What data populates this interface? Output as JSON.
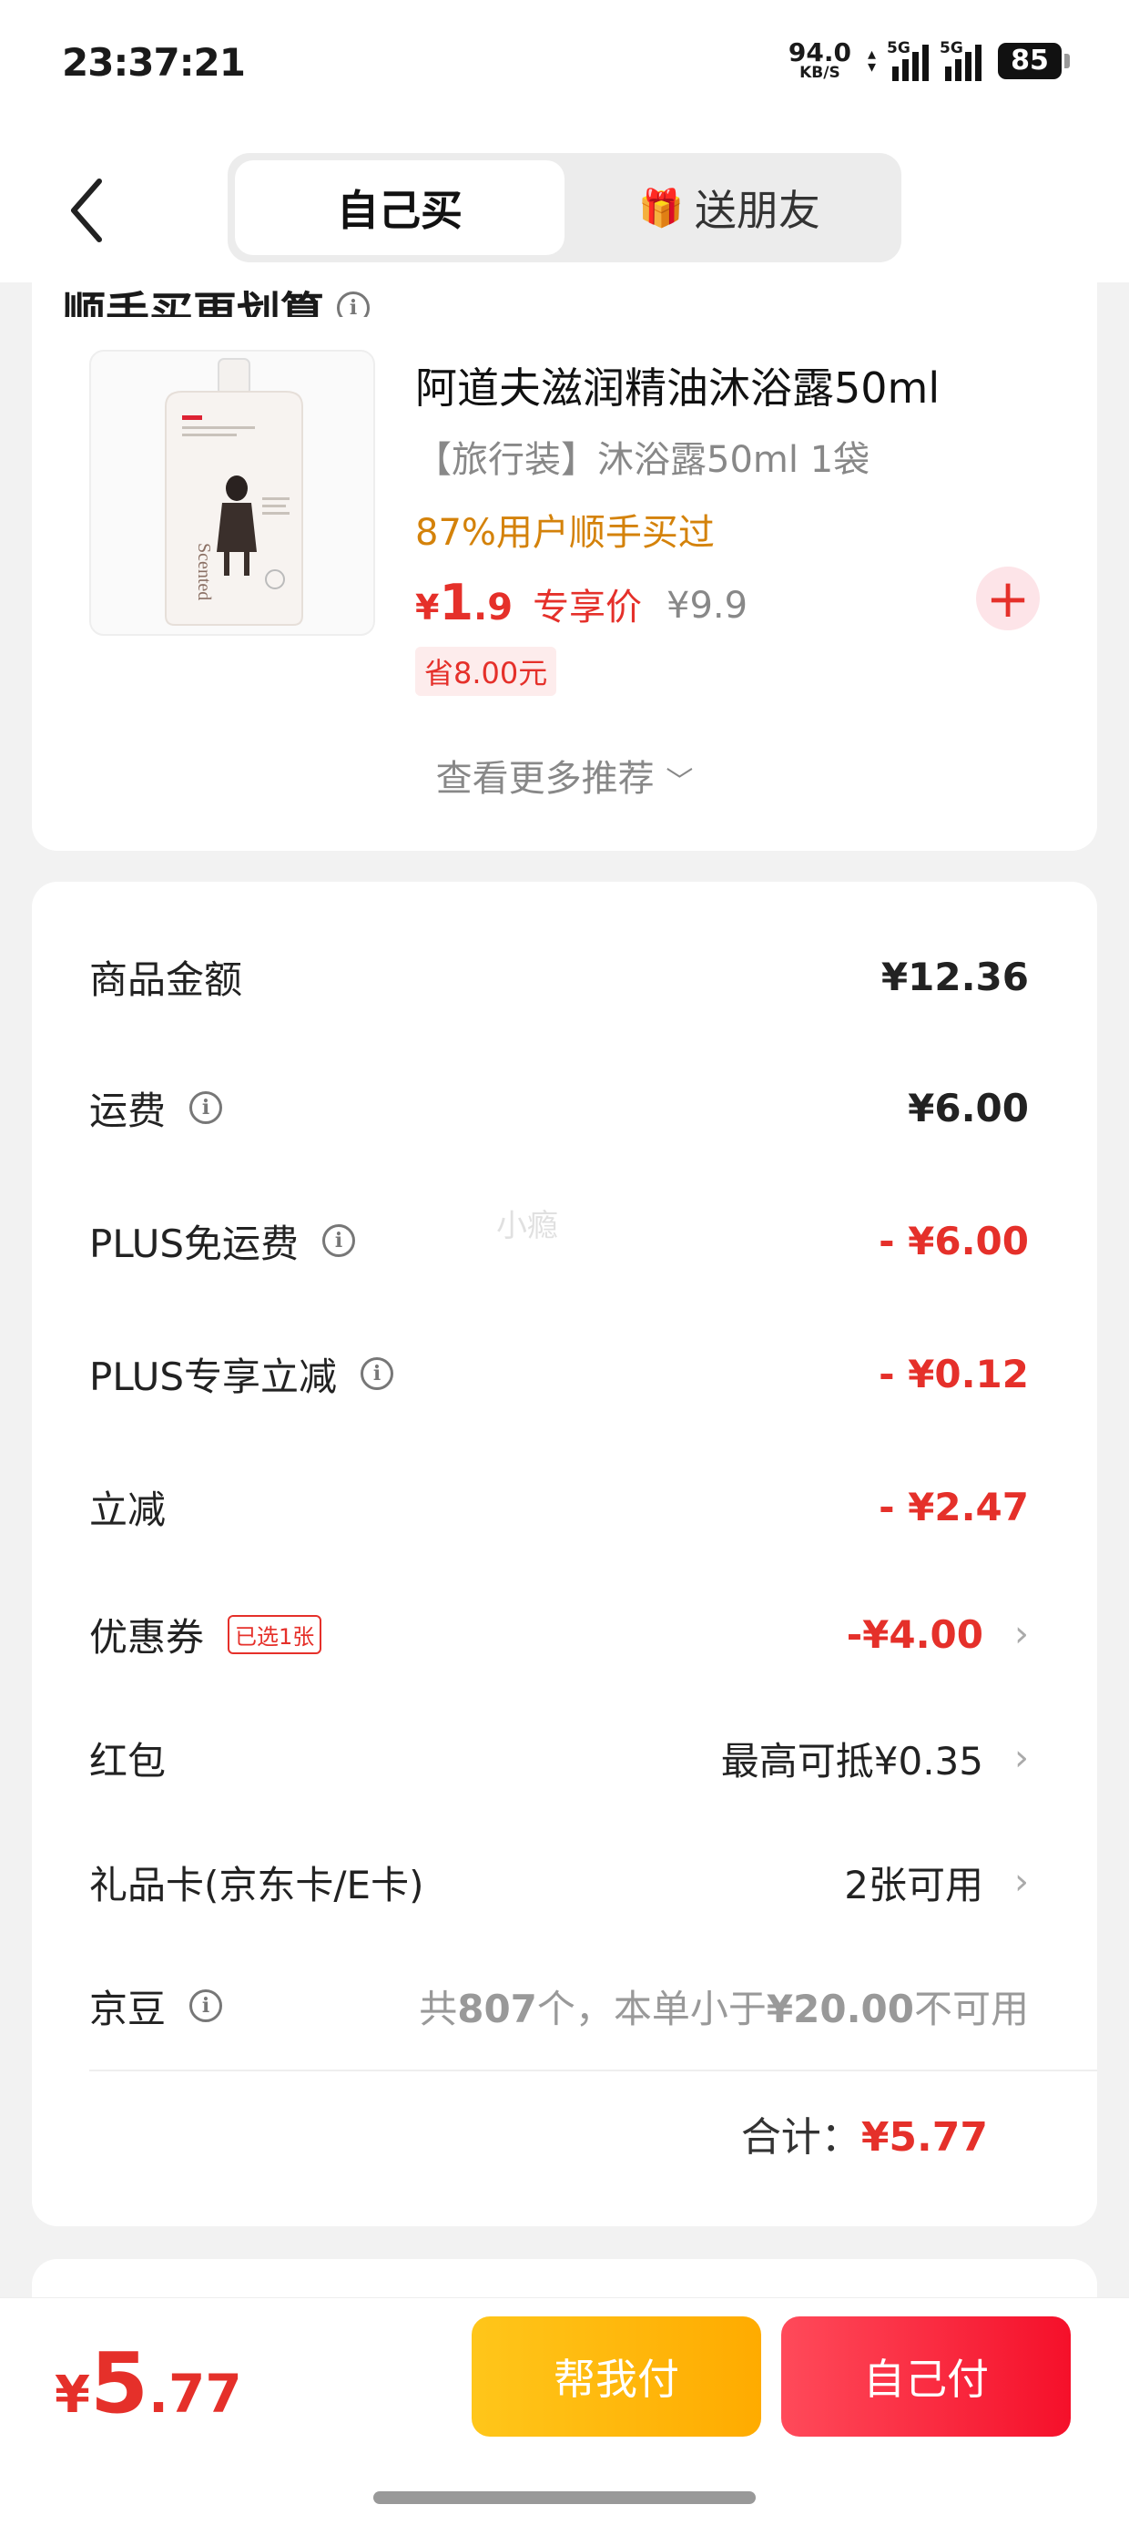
{
  "status_bar": {
    "time": "23:37:21",
    "net_speed": "94.0",
    "net_unit": "KB/S",
    "sim1": "5G",
    "sim2": "5G",
    "battery": "85"
  },
  "header": {
    "tabs": [
      {
        "label": "自己买",
        "active": true
      },
      {
        "label": "送朋友",
        "icon": "gift-icon"
      }
    ]
  },
  "recommend": {
    "title": "顺手买更划算",
    "product": {
      "name": "阿道夫滋润精油沐浴露50ml",
      "spec": "【旅行装】沐浴露50ml 1袋",
      "tip": "87%用户顺手买过",
      "price_yen": "¥",
      "price_int": "1",
      "price_dec": ".9",
      "price_label": "专享价",
      "orig_price": "¥9.9",
      "save": "省8.00元"
    },
    "more": "查看更多推荐"
  },
  "summary": {
    "rows": [
      {
        "label": "商品金额",
        "value": "¥12.36"
      },
      {
        "label": "运费",
        "value": "¥6.00"
      },
      {
        "label": "PLUS免运费",
        "value": "- ¥6.00"
      },
      {
        "label": "PLUS专享立减",
        "value": "- ¥0.12"
      },
      {
        "label": "立减",
        "value": "- ¥2.47"
      },
      {
        "label": "优惠券",
        "badge": "已选1张",
        "value": "-¥4.00"
      },
      {
        "label": "红包",
        "value": "最高可抵¥0.35"
      },
      {
        "label": "礼品卡(京东卡/E卡)",
        "value": "2张可用"
      },
      {
        "label": "京豆",
        "value_prefix": "共",
        "value_count": "807",
        "value_mid": "个，本单小于",
        "value_amount": "¥20.00",
        "value_suffix": "不可用"
      }
    ],
    "total_label": "合计：",
    "total_value": "¥5.77"
  },
  "watermark": "小瘾",
  "bottom": {
    "pay_yen": "¥",
    "pay_int": "5",
    "pay_dec": ".77",
    "help_pay": "帮我付",
    "self_pay": "自己付"
  },
  "colors": {
    "accent_red": "#e5302a",
    "tip_orange": "#d4820a",
    "help_button": "#ffb800",
    "self_button": "#f5102a"
  }
}
